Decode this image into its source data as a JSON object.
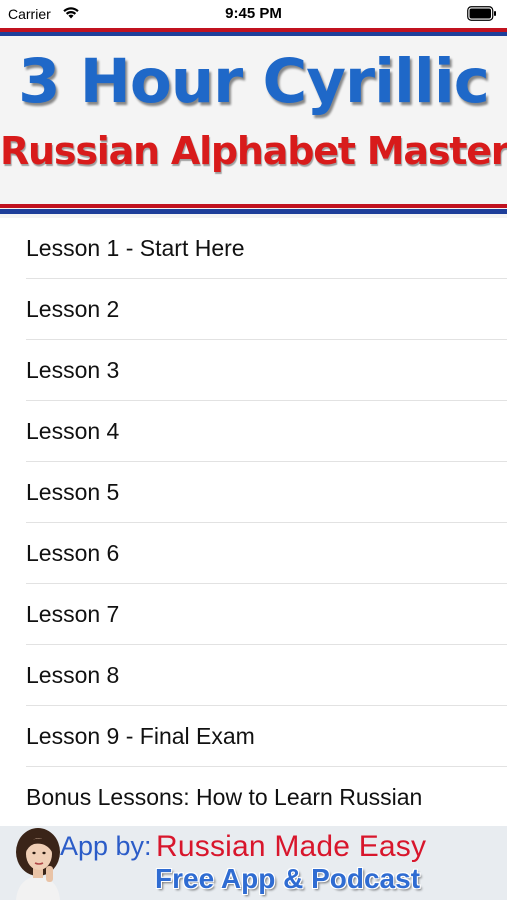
{
  "status_bar": {
    "carrier": "Carrier",
    "time": "9:45 PM",
    "wifi_icon": "wifi-icon",
    "battery_icon": "battery-icon"
  },
  "header": {
    "title": "3 Hour Cyrillic",
    "subtitle": "Russian Alphabet Mastery",
    "colors": {
      "title": "#1f68c8",
      "subtitle": "#d81b1b",
      "stripe_red": "#c1121f",
      "stripe_blue": "#1e3f9a"
    }
  },
  "lessons": [
    {
      "label": "Lesson 1 - Start Here"
    },
    {
      "label": "Lesson 2"
    },
    {
      "label": "Lesson 3"
    },
    {
      "label": "Lesson 4"
    },
    {
      "label": "Lesson 5"
    },
    {
      "label": "Lesson 6"
    },
    {
      "label": "Lesson 7"
    },
    {
      "label": "Lesson 8"
    },
    {
      "label": "Lesson 9 - Final Exam"
    },
    {
      "label": "Bonus Lessons: How to Learn Russian"
    }
  ],
  "footer_ad": {
    "prefix": "App by:",
    "brand": "Russian Made Easy",
    "tagline": "Free App & Podcast",
    "avatar_icon": "woman-avatar-icon",
    "colors": {
      "prefix": "#2b5cc8",
      "brand": "#d8162c",
      "tagline": "#2f6cd2"
    }
  }
}
